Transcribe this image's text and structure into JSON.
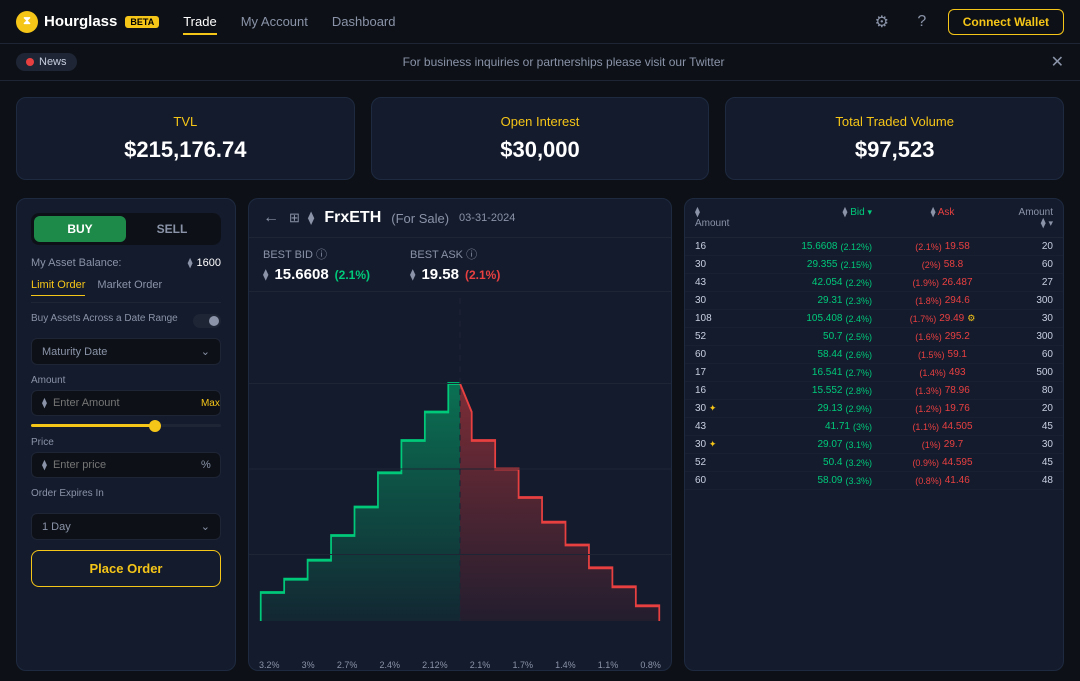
{
  "app": {
    "name": "Hourglass",
    "beta": "BETA"
  },
  "nav": {
    "items": [
      {
        "label": "Trade",
        "active": true
      },
      {
        "label": "My Account",
        "active": false
      },
      {
        "label": "Dashboard",
        "active": false
      }
    ]
  },
  "header": {
    "connect_btn": "Connect Wallet"
  },
  "news": {
    "badge": "News",
    "text": "For business inquiries or partnerships please visit our Twitter"
  },
  "stats": [
    {
      "label": "TVL",
      "value": "$215,176.74"
    },
    {
      "label": "Open Interest",
      "value": "$30,000"
    },
    {
      "label": "Total Traded Volume",
      "value": "$97,523"
    }
  ],
  "trade_form": {
    "buy_label": "BUY",
    "sell_label": "SELL",
    "asset_balance_label": "My Asset Balance:",
    "balance_value": "1600",
    "limit_order_tab": "Limit Order",
    "market_order_tab": "Market Order",
    "date_range_label": "Buy Assets Across a Date Range",
    "maturity_date": "Maturity Date",
    "amount_label": "Amount",
    "amount_placeholder": "Enter Amount",
    "max_label": "Max",
    "price_label": "Price",
    "price_placeholder": "Enter price",
    "expires_label": "Order Expires In",
    "expires_value": "1 Day",
    "place_order_btn": "Place Order"
  },
  "chart": {
    "asset_name": "FrxETH",
    "asset_tag": "(For Sale)",
    "date": "03-31-2024",
    "best_bid_label": "BEST BID",
    "best_ask_label": "BEST ASK",
    "best_bid_price": "15.6608",
    "best_bid_pct": "(2.1%)",
    "best_ask_price": "19.58",
    "best_ask_pct": "(2.1%)",
    "x_axis_labels": [
      "3.2%",
      "3%",
      "2.7%",
      "2.4%",
      "2.12%",
      "2.1%",
      "1.7%",
      "1.4%",
      "1.1%",
      "0.8%"
    ]
  },
  "orderbook": {
    "col_amount": "Amount",
    "col_bid": "Bid",
    "col_ask": "Ask",
    "col_amount_r": "Amount",
    "rows": [
      {
        "amount_l": "16",
        "bid": "15.6608",
        "bid_pct": "(2.12%)",
        "ask_pct": "(2.1%)",
        "ask": "19.58",
        "amount_r": "20"
      },
      {
        "amount_l": "30",
        "bid": "29.355",
        "bid_pct": "(2.15%)",
        "ask_pct": "(2%)",
        "ask": "58.8",
        "amount_r": "60"
      },
      {
        "amount_l": "43",
        "bid": "42.054",
        "bid_pct": "(2.2%)",
        "ask_pct": "(1.9%)",
        "ask": "26.487",
        "amount_r": "27"
      },
      {
        "amount_l": "30",
        "bid": "29.31",
        "bid_pct": "(2.3%)",
        "ask_pct": "(1.8%)",
        "ask": "294.6",
        "amount_r": "300"
      },
      {
        "amount_l": "108",
        "bid": "105.408",
        "bid_pct": "(2.4%)",
        "ask_pct": "(1.7%)",
        "ask": "29.49",
        "amount_r": "30",
        "special": true
      },
      {
        "amount_l": "52",
        "bid": "50.7",
        "bid_pct": "(2.5%)",
        "ask_pct": "(1.6%)",
        "ask": "295.2",
        "amount_r": "300"
      },
      {
        "amount_l": "60",
        "bid": "58.44",
        "bid_pct": "(2.6%)",
        "ask_pct": "(1.5%)",
        "ask": "59.1",
        "amount_r": "60"
      },
      {
        "amount_l": "17",
        "bid": "16.541",
        "bid_pct": "(2.7%)",
        "ask_pct": "(1.4%)",
        "ask": "493",
        "amount_r": "500"
      },
      {
        "amount_l": "16",
        "bid": "15.552",
        "bid_pct": "(2.8%)",
        "ask_pct": "(1.3%)",
        "ask": "78.96",
        "amount_r": "80"
      },
      {
        "amount_l": "30",
        "bid": "29.13",
        "bid_pct": "(2.9%)",
        "ask_pct": "(1.2%)",
        "ask": "19.76",
        "amount_r": "20",
        "special2": true
      },
      {
        "amount_l": "43",
        "bid": "41.71",
        "bid_pct": "(3%)",
        "ask_pct": "(1.1%)",
        "ask": "44.505",
        "amount_r": "45"
      },
      {
        "amount_l": "30",
        "bid": "29.07",
        "bid_pct": "(3.1%)",
        "ask_pct": "(1%)",
        "ask": "29.7",
        "amount_r": "30",
        "special2": true
      },
      {
        "amount_l": "52",
        "bid": "50.4",
        "bid_pct": "(3.2%)",
        "ask_pct": "(0.9%)",
        "ask": "44.595",
        "amount_r": "45"
      },
      {
        "amount_l": "60",
        "bid": "58.09",
        "bid_pct": "(3.3%)",
        "ask_pct": "(0.8%)",
        "ask": "41.46",
        "amount_r": "48"
      }
    ]
  }
}
